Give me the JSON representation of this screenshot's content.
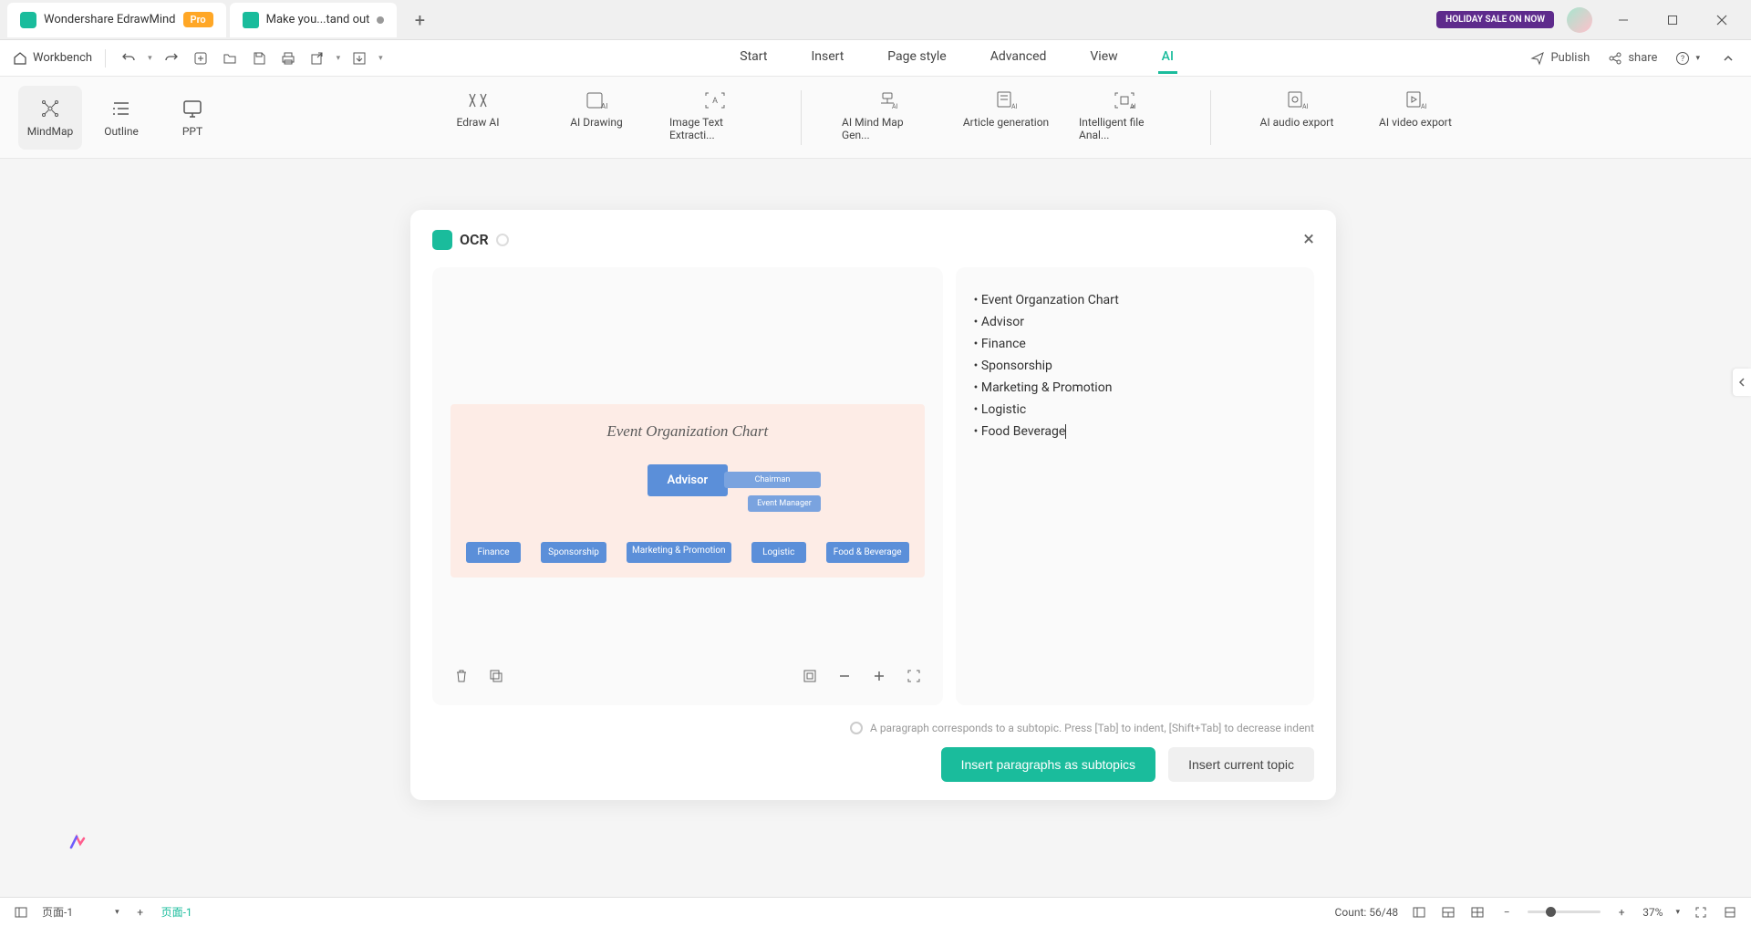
{
  "titlebar": {
    "app_name": "Wondershare EdrawMind",
    "pro_badge": "Pro",
    "tab_title": "Make you...tand out",
    "holiday_badge": "HOLIDAY SALE ON NOW"
  },
  "toolbar": {
    "workbench": "Workbench",
    "menu_tabs": [
      "Start",
      "Insert",
      "Page style",
      "Advanced",
      "View",
      "AI"
    ],
    "active_tab_index": 5,
    "publish": "Publish",
    "share": "share"
  },
  "ribbon": {
    "view_modes": [
      {
        "label": "MindMap",
        "active": true
      },
      {
        "label": "Outline",
        "active": false
      },
      {
        "label": "PPT",
        "active": false
      }
    ],
    "ai_tools": [
      "Edraw AI",
      "AI Drawing",
      "Image Text Extracti...",
      "AI Mind Map Gen...",
      "Article generation",
      "Intelligent file Anal...",
      "AI audio export",
      "AI video export"
    ]
  },
  "ocr_dialog": {
    "title": "OCR",
    "image": {
      "title": "Event Organization Chart",
      "advisor": "Advisor",
      "chairman": "Chairman",
      "event_manager": "Event Manager",
      "departments": [
        "Finance",
        "Sponsorship",
        "Marketing & Promotion",
        "Logistic",
        "Food & Beverage"
      ]
    },
    "results": [
      "Event Organzation Chart",
      "Advisor",
      "Finance",
      "Sponsorship",
      "Marketing & Promotion",
      "Logistic",
      "Food Beverage"
    ],
    "hint": "A paragraph corresponds to a subtopic. Press [Tab] to indent, [Shift+Tab] to decrease indent",
    "btn_primary": "Insert paragraphs as subtopics",
    "btn_secondary": "Insert current topic"
  },
  "statusbar": {
    "page_select": "页面-1",
    "page_label": "页面-1",
    "count": "Count: 56/48",
    "zoom": "37%"
  }
}
